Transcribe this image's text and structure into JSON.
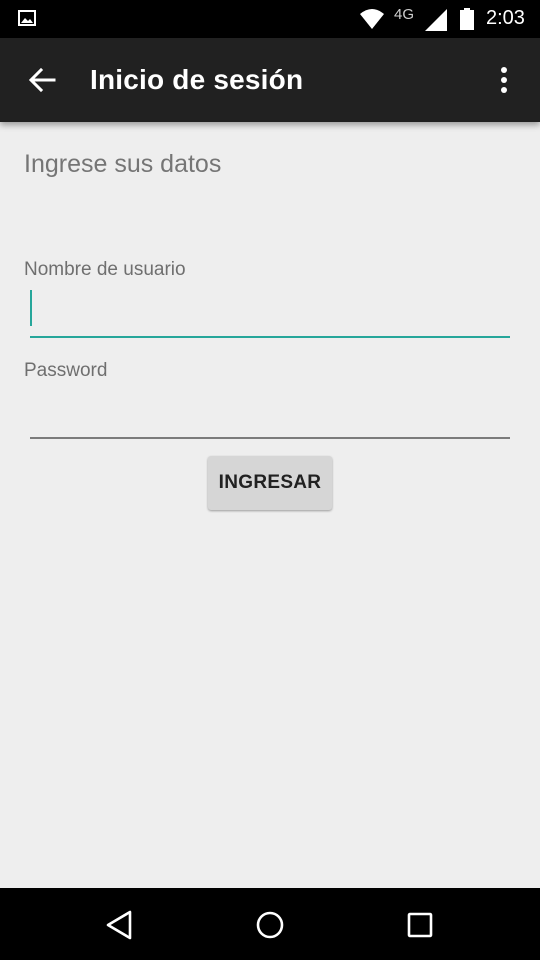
{
  "status_bar": {
    "network_type": "4G",
    "time": "2:03",
    "icons": [
      "image-notification-icon",
      "wifi-icon",
      "cell-signal-icon",
      "battery-icon"
    ]
  },
  "app_bar": {
    "title": "Inicio de sesión",
    "back_icon": "arrow-left-icon",
    "overflow_icon": "more-vertical-icon"
  },
  "form": {
    "heading": "Ingrese sus datos",
    "username_label": "Nombre de usuario",
    "username_value": "",
    "password_label": "Password",
    "password_value": "",
    "submit_label": "INGRESAR"
  },
  "navigation": {
    "icons": [
      "back-triangle-icon",
      "home-circle-icon",
      "recents-square-icon"
    ]
  },
  "colors": {
    "accent": "#26a69a",
    "app_bar": "#212121",
    "background": "#eeeeee",
    "button": "#d6d6d6"
  }
}
